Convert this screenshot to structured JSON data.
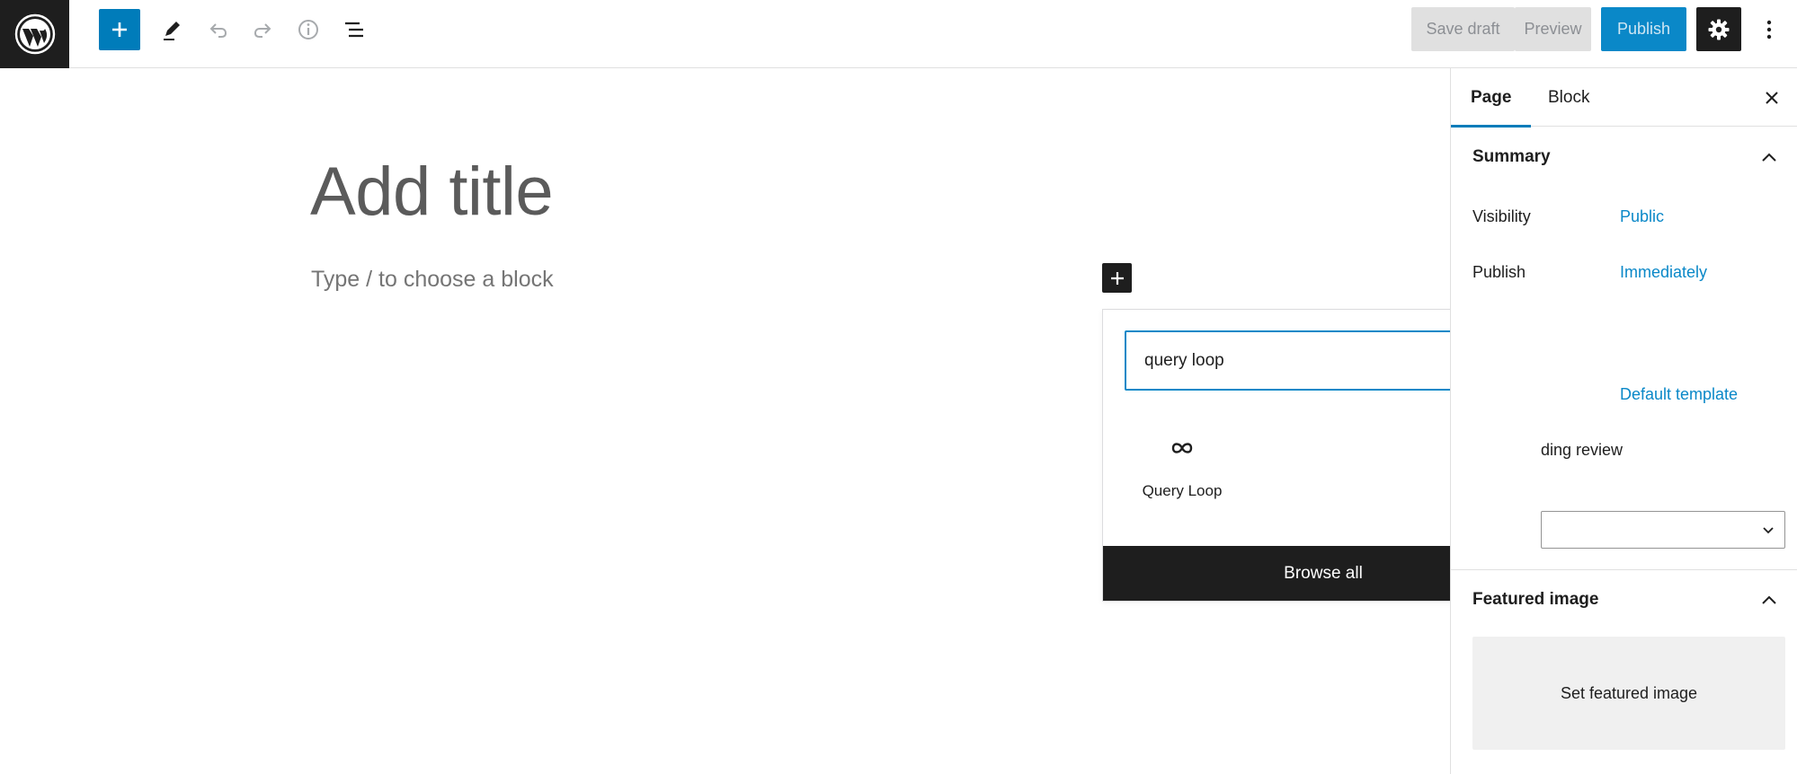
{
  "toolbar": {
    "save_draft_label": "Save draft",
    "preview_label": "Preview",
    "publish_label": "Publish"
  },
  "editor": {
    "title_placeholder": "Add title",
    "block_placeholder": "Type / to choose a block"
  },
  "inserter": {
    "search_value": "query loop",
    "results": [
      {
        "label": "Query Loop",
        "icon": "loop-icon"
      }
    ],
    "browse_all_label": "Browse all"
  },
  "sidebar": {
    "tabs": [
      {
        "label": "Page",
        "active": true
      },
      {
        "label": "Block",
        "active": false
      }
    ],
    "summary": {
      "title": "Summary",
      "visibility_label": "Visibility",
      "visibility_value": "Public",
      "publish_label": "Publish",
      "publish_value": "Immediately",
      "template_value": "Default template",
      "pending_review_partial": "ding review"
    },
    "featured_image": {
      "title": "Featured image",
      "button_label": "Set featured image"
    }
  },
  "colors": {
    "accent": "#007cba",
    "dark": "#1e1e1e",
    "link": "#0a88c8"
  }
}
